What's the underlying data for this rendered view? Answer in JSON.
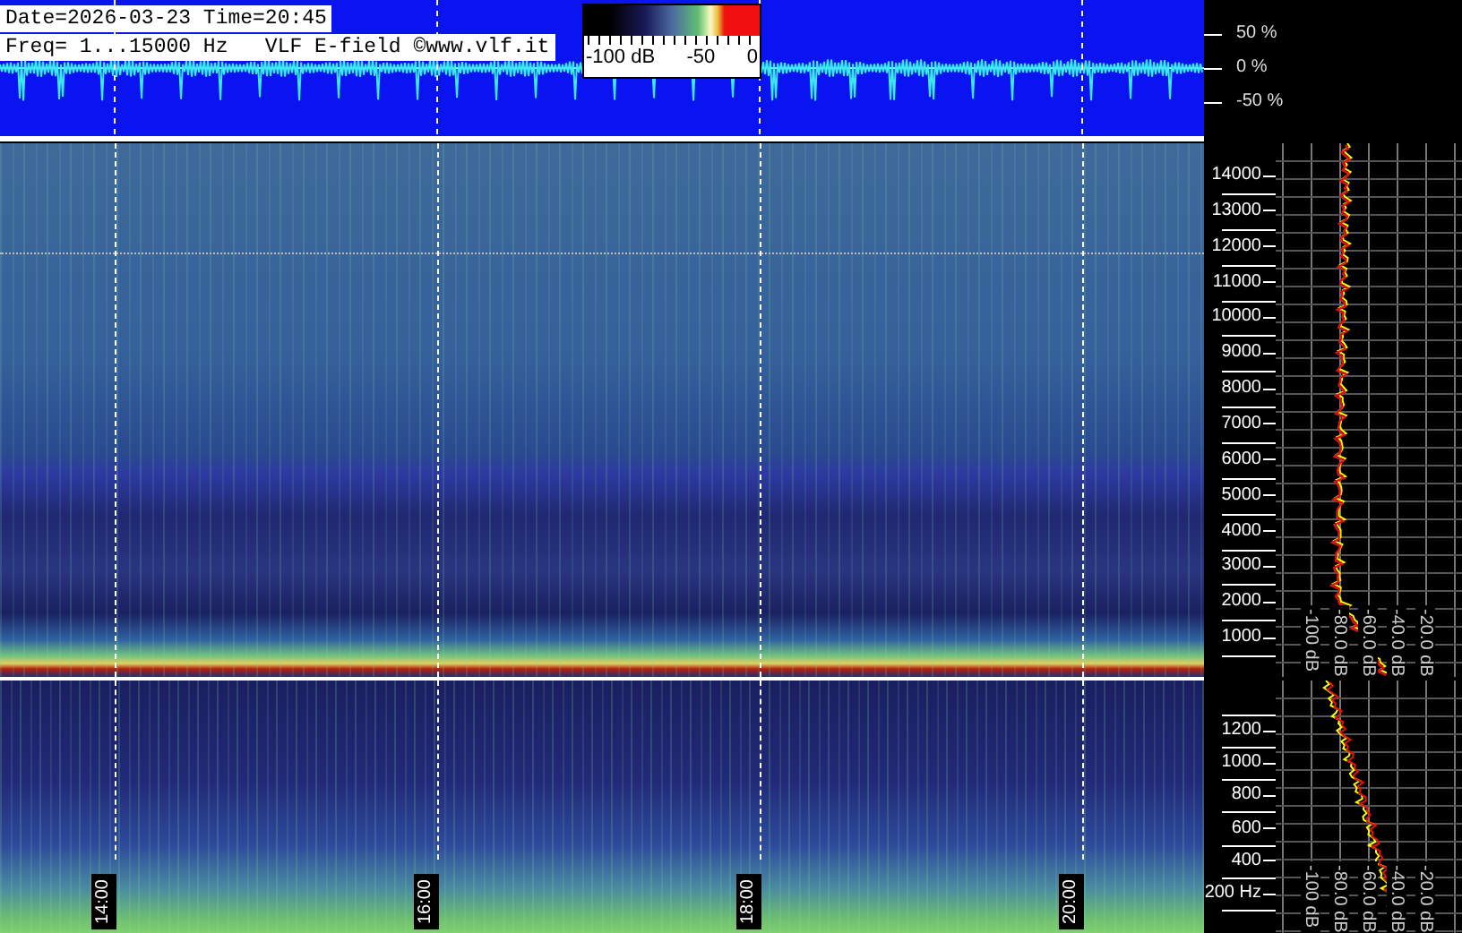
{
  "header": {
    "date_line": "Date=2026-03-23 Time=20:45",
    "freq_line": "Freq= 1...15000 Hz   VLF E-field ©www.vlf.it"
  },
  "color_scale": {
    "labels": [
      "-100 dB",
      "-50",
      "0"
    ]
  },
  "waveform_axis": {
    "labels": [
      "50 %",
      "0 %",
      "-50 %"
    ]
  },
  "upper_spectrogram": {
    "freq_labels": [
      "14000",
      "13000",
      "12000",
      "11000",
      "10000",
      "9000",
      "8000",
      "7000",
      "6000",
      "5000",
      "4000",
      "3000",
      "2000",
      "1000"
    ],
    "profile_db_labels": [
      "-100 dB",
      "-80.0 dB",
      "-60.0 dB",
      "-40.0 dB",
      "-20.0 dB"
    ]
  },
  "lower_spectrogram": {
    "freq_labels": [
      "1200",
      "1000",
      "800",
      "600",
      "400",
      "200 Hz"
    ],
    "profile_db_labels": [
      "-100 dB",
      "-80.0 dB",
      "-60.0 dB",
      "-40.0 dB",
      "-20.0 dB"
    ],
    "time_labels": [
      "14:00",
      "16:00",
      "18:00",
      "20:00"
    ]
  }
}
